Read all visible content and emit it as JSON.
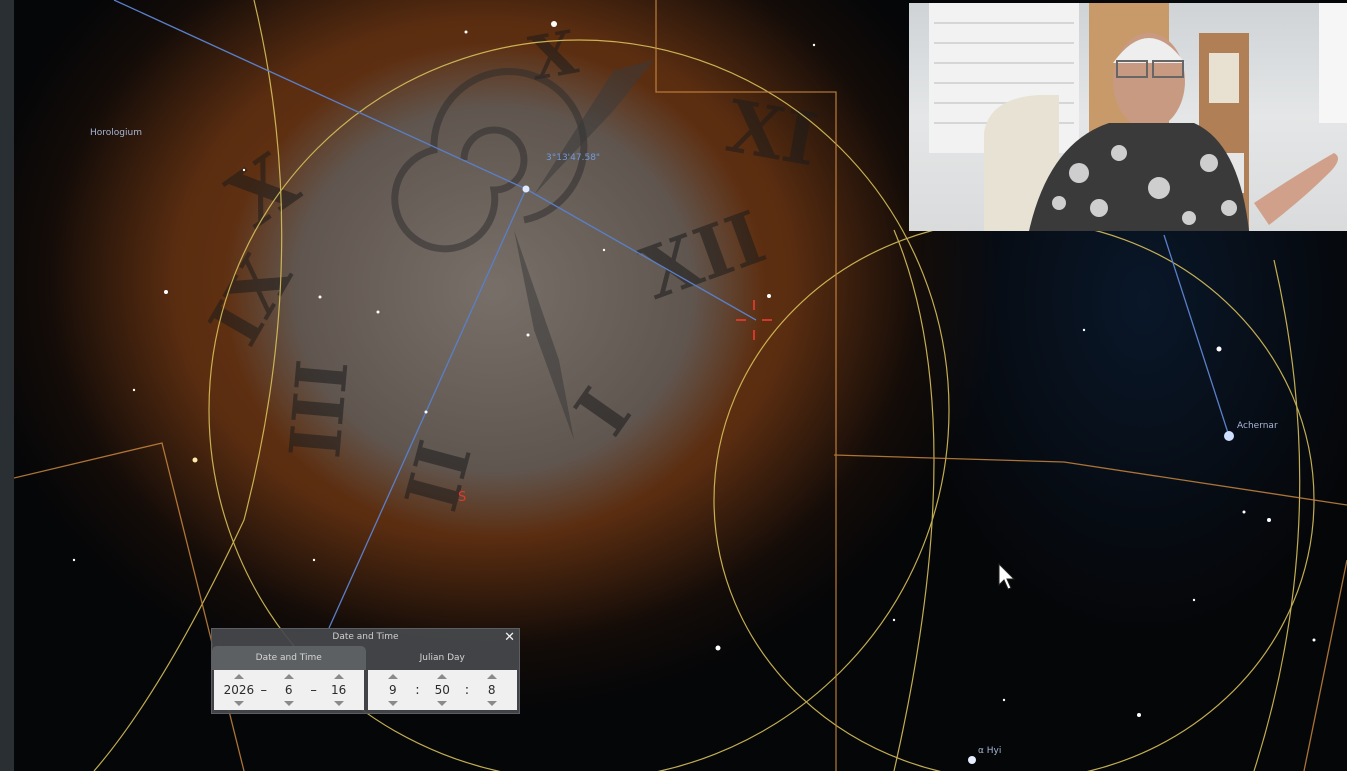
{
  "sky": {
    "constellation_label": "Horologium",
    "coordinate_readout": "3°13'47.58\"",
    "cardinal_marker": "S",
    "star_labels": {
      "achernar": "Achernar",
      "alpha_hyi": "α Hyi"
    }
  },
  "datetime_dialog": {
    "title": "Date and Time",
    "close_label": "✕",
    "tabs": [
      {
        "label": "Date and Time"
      },
      {
        "label": "Julian Day"
      }
    ],
    "date": {
      "year": "2026",
      "month": "6",
      "day": "16",
      "separator": "–"
    },
    "time": {
      "hour": "9",
      "minute": "50",
      "second": "8",
      "separator": ":"
    }
  },
  "colors": {
    "grid_yellow": "#d8c05a",
    "boundary_orange": "#c8863e",
    "line_blue": "#5a7fc8",
    "marker_red": "#e03a2a"
  },
  "icons": {
    "pointer": "mouse-pointer-icon",
    "close": "close-icon"
  }
}
